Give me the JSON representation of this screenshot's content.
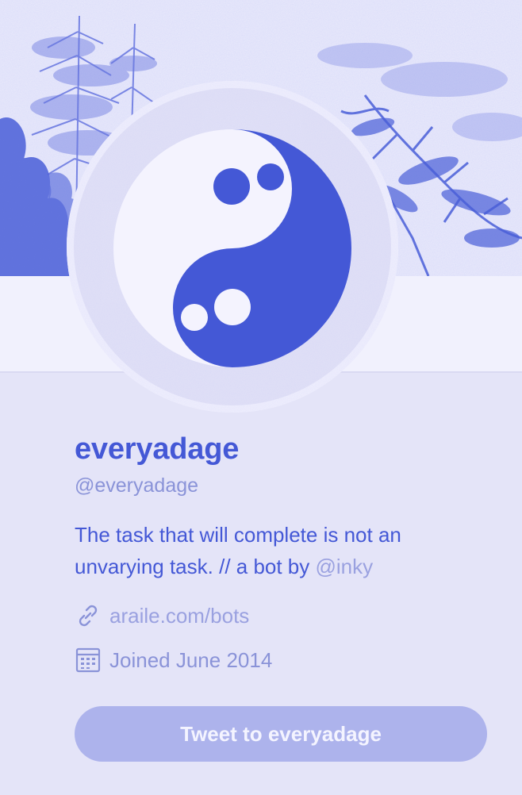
{
  "colors": {
    "background": "#e4e4f8",
    "accent": "#4458d6",
    "muted": "#8a93d8",
    "button_bg": "#adb3ec",
    "button_text": "#f4f4ff"
  },
  "profile": {
    "display_name": "everyadage",
    "handle": "@everyadage",
    "bio_text": "The task that will complete is not an unvarying task. // a bot by ",
    "bio_mention": "@inky",
    "website": "araile.com/bots",
    "joined": "Joined June 2014",
    "avatar_icon": "yin-yang-icon",
    "link_icon": "link-icon",
    "calendar_icon": "calendar-icon"
  },
  "actions": {
    "tweet_button_label": "Tweet to everyadage"
  }
}
